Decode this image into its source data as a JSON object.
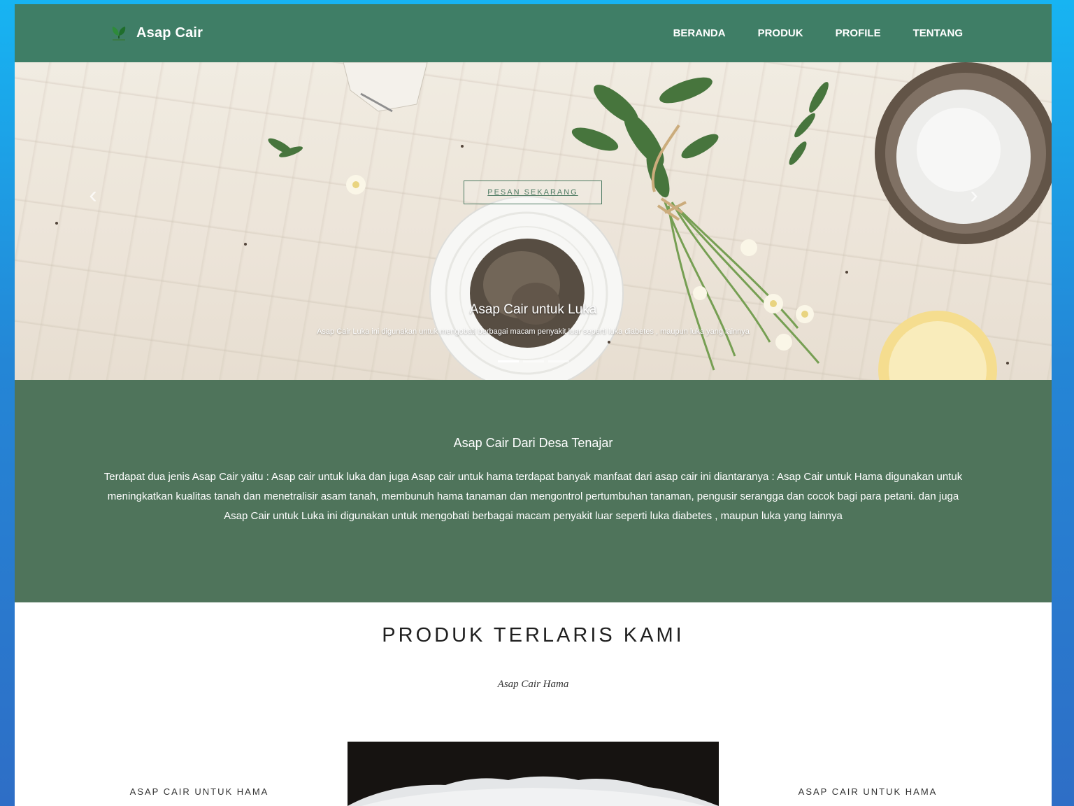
{
  "navbar": {
    "brand": "Asap Cair",
    "links": [
      "BERANDA",
      "PRODUK",
      "PROFILE",
      "TENTANG"
    ]
  },
  "hero": {
    "cta_label": "PESAN SEKARANG",
    "caption_title": "Asap Cair untuk Luka",
    "caption_text": "Asap Cair Luka ini digunakan untuk mengobati berbagai macam penyakit luar seperti luka diabetes , maupun luka yang lainnya",
    "indicator_count": 3,
    "active_indicator": 1,
    "prev_icon": "chevron-left-icon",
    "next_icon": "chevron-right-icon"
  },
  "about": {
    "title": "Asap Cair Dari Desa Tenajar",
    "text": "Terdapat dua jenis Asap Cair yaitu : Asap cair untuk luka dan juga Asap cair untuk hama terdapat banyak manfaat dari asap cair ini diantaranya : Asap Cair untuk Hama digunakan untuk meningkatkan kualitas tanah dan menetralisir asam tanah, membunuh hama tanaman dan mengontrol pertumbuhan tanaman, pengusir serangga dan cocok bagi para petani. dan juga Asap Cair untuk Luka ini digunakan untuk mengobati berbagai macam penyakit luar seperti luka diabetes , maupun luka yang lainnya"
  },
  "products": {
    "title": "PRODUK TERLARIS KAMI",
    "subtitle": "Asap Cair Hama",
    "left_label": "ASAP CAIR UNTUK HAMA",
    "right_label": "ASAP CAIR UNTUK HAMA"
  },
  "colors": {
    "navbar": "#3f7e66",
    "about_bg": "#4f745b",
    "window_bg": "#2486d6"
  }
}
